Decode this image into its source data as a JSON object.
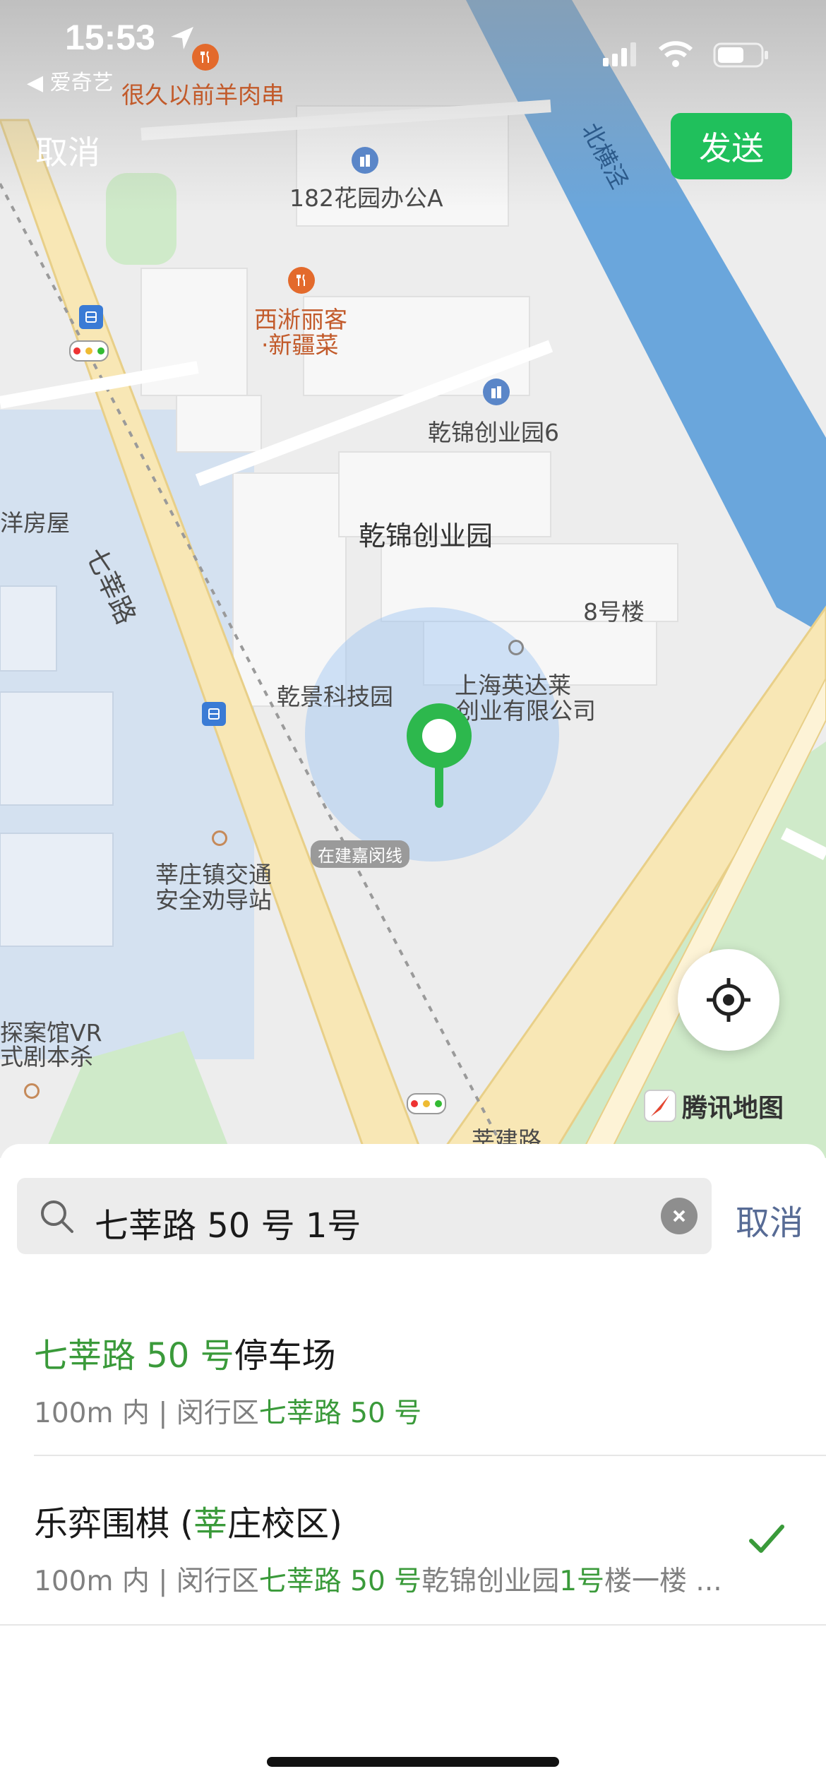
{
  "status_bar": {
    "time": "15:53",
    "back_app": "◀ 爱奇艺"
  },
  "top_bar": {
    "cancel_label": "取消",
    "send_label": "发送",
    "send_color": "#20c05c"
  },
  "map": {
    "labels": {
      "restaurant1": "很久以前羊肉串",
      "office182": "182花园办公A",
      "restaurant2_line1": "西淅丽客",
      "restaurant2_line2": "·新疆菜",
      "park6": "乾锦创业园6",
      "park": "乾锦创业园",
      "building8": "8号楼",
      "company_line1": "上海英达莱",
      "company_line2": "创业有限公司",
      "tech_park": "乾景科技园",
      "construction": "在建嘉闵线",
      "road_qixin": "七莘路",
      "river": "北横泾",
      "house": "洋房屋",
      "traffic_line1": "莘庄镇交通",
      "traffic_line2": "安全劝导站",
      "vr_line1": "探案馆VR",
      "vr_line2": "式剧本杀",
      "bottom_road": "莘建路"
    },
    "provider": "腾讯地图",
    "pin_color": "#2db84d"
  },
  "search": {
    "query": "七莘路 50 号 1号",
    "cancel_label": "取消"
  },
  "results": [
    {
      "title_parts": [
        "七莘路 50 号",
        "停车场"
      ],
      "sub_parts": [
        "100m 内 | 闵行区",
        "七莘路 50 号"
      ],
      "selected": false
    },
    {
      "title_parts": [
        "乐弈围棋 (",
        "莘",
        "庄校区)"
      ],
      "sub_parts": [
        "100m 内 | 闵行区",
        "七莘路 50 号",
        "乾锦创业园",
        "1号",
        "楼一楼 ..."
      ],
      "selected": true
    }
  ],
  "accent_color": "#3a9a3a"
}
